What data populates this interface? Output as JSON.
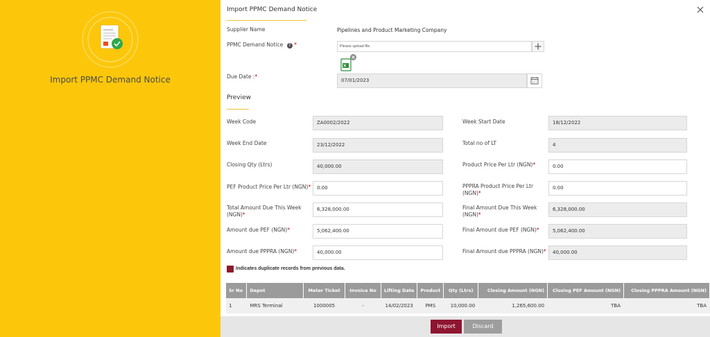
{
  "hero": {
    "title": "Import PPMC Demand Notice"
  },
  "dialog": {
    "title": "Import PPMC Demand Notice",
    "supplier_label": "Supplier Name",
    "supplier_value": "Pipelines and Product Marketing Company",
    "notice_label": "PPMC Demand Notice",
    "file_placeholder": "Please upload file",
    "due_date_label": "Due Date :",
    "due_date_value": "07/01/2023"
  },
  "preview": {
    "title": "Preview",
    "fields": {
      "week_code": {
        "label": "Week Code",
        "value": "ZA0002/2022"
      },
      "week_start_date": {
        "label": "Week Start Date",
        "value": "18/12/2022"
      },
      "week_end_date": {
        "label": "Week End Date",
        "value": "23/12/2022"
      },
      "total_no_of_lt": {
        "label": "Total no of LT",
        "value": "4"
      },
      "closing_qty": {
        "label": "Closing Qty (Ltrs)",
        "value": "40,000.00"
      },
      "product_price": {
        "label": "Product Price Per Ltr (NGN)",
        "value": "0.00"
      },
      "pef_price": {
        "label": "PEF Product Price Per Ltr (NGN)",
        "value": "0.00"
      },
      "pppra_price": {
        "label": "PPPRA Product Price Per Ltr (NGN)",
        "value": "0.00"
      },
      "total_amount_due": {
        "label": "Total Amount Due This Week (NGN)",
        "value": "6,328,000.00"
      },
      "final_amount_due": {
        "label": "Final Amount Due This Week (NGN)",
        "value": "6,328,000.00"
      },
      "amount_due_pef": {
        "label": "Amount due PEF (NGN)",
        "value": "5,062,400.00"
      },
      "final_amount_pef": {
        "label": "Final Amount due PEF (NGN)",
        "value": "5,062,400.00"
      },
      "amount_due_pppra": {
        "label": "Amount due PPPRA (NGN)",
        "value": "40,000.00"
      },
      "final_amount_pppra": {
        "label": "Final Amount due PPPRA (NGN)",
        "value": "40,000.00"
      }
    },
    "legend": "Indicates duplicate records from previous data."
  },
  "table": {
    "headers": [
      "Sr No",
      "Depot",
      "Meter Ticket",
      "Invoice No",
      "Lifting Date",
      "Product",
      "Qty (Ltrs)",
      "Closing Amount (NGN)",
      "Closing PEF Amount (NGN)",
      "Closing PPPRA Amount (NGN)"
    ],
    "rows": [
      [
        "1",
        "MRS Terminal",
        "1000005",
        "-",
        "14/02/2023",
        "PMS",
        "10,000.00",
        "1,265,600.00",
        "TBA",
        "TBA"
      ]
    ]
  },
  "buttons": {
    "import": "Import",
    "discard": "Discard"
  },
  "colors": {
    "accent": "#fcc70b",
    "primary_button": "#8e1530",
    "duplicate_marker": "#8b1a2b"
  },
  "required_mark": "*"
}
